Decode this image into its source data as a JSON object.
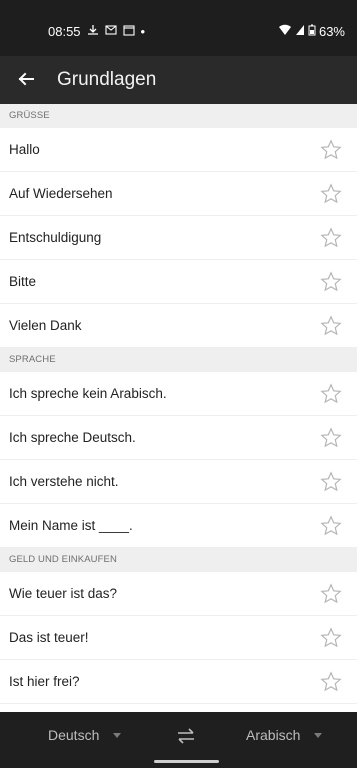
{
  "status": {
    "time": "08:55",
    "battery": "63%"
  },
  "appbar": {
    "title": "Grundlagen"
  },
  "sections": [
    {
      "header": "GRÜSSE",
      "items": [
        "Hallo",
        "Auf Wiedersehen",
        "Entschuldigung",
        "Bitte",
        "Vielen Dank"
      ]
    },
    {
      "header": "SPRACHE",
      "items": [
        "Ich spreche kein Arabisch.",
        "Ich spreche Deutsch.",
        "Ich verstehe nicht.",
        "Mein Name ist ____."
      ]
    },
    {
      "header": "GELD UND EINKAUFEN",
      "items": [
        "Wie teuer ist das?",
        "Das ist teuer!",
        "Ist hier frei?"
      ]
    }
  ],
  "bottombar": {
    "source_language": "Deutsch",
    "target_language": "Arabisch"
  }
}
